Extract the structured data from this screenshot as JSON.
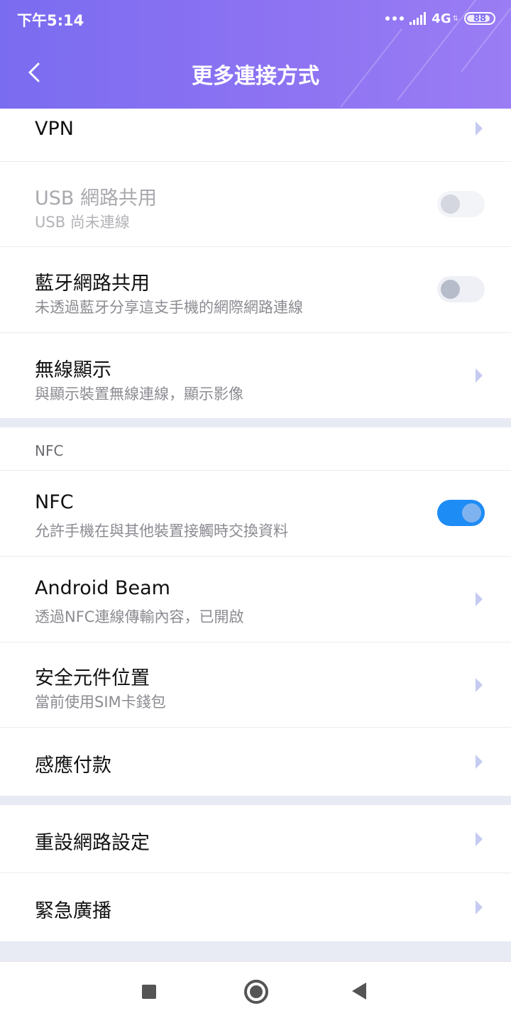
{
  "status_bar": {
    "time": "下午5:14",
    "network": "4G",
    "battery": "88"
  },
  "header": {
    "title": "更多連接方式"
  },
  "rows": {
    "vpn": {
      "title": "VPN"
    },
    "usb_tethering": {
      "title": "USB 網路共用",
      "subtitle": "USB 尚未連線",
      "enabled": false,
      "toggle": "off"
    },
    "bt_tethering": {
      "title": "藍牙網路共用",
      "subtitle": "未透過藍牙分享這支手機的網際網路連線",
      "toggle": "off"
    },
    "wireless_display": {
      "title": "無線顯示",
      "subtitle": "與顯示裝置無線連線，顯示影像"
    },
    "nfc_section": {
      "label": "NFC"
    },
    "nfc": {
      "title": "NFC",
      "subtitle": "允許手機在與其他裝置接觸時交換資料",
      "toggle": "on"
    },
    "android_beam": {
      "title": "Android Beam",
      "subtitle": "透過NFC連線傳輸內容，已開啟"
    },
    "secure_element": {
      "title": "安全元件位置",
      "subtitle": "當前使用SIM卡錢包"
    },
    "tap_pay": {
      "title": "感應付款"
    },
    "reset_network": {
      "title": "重設網路設定"
    },
    "emergency_broadcast": {
      "title": "緊急廣播"
    }
  },
  "colors": {
    "header_start": "#7a6cf0",
    "header_end": "#9a7df4",
    "toggle_on": "#1e8cf5",
    "chevron": "#c5cbf0"
  },
  "icons": [
    "back-icon",
    "chevron-right-icon",
    "recent-apps-icon",
    "home-icon",
    "back-triangle-icon"
  ]
}
